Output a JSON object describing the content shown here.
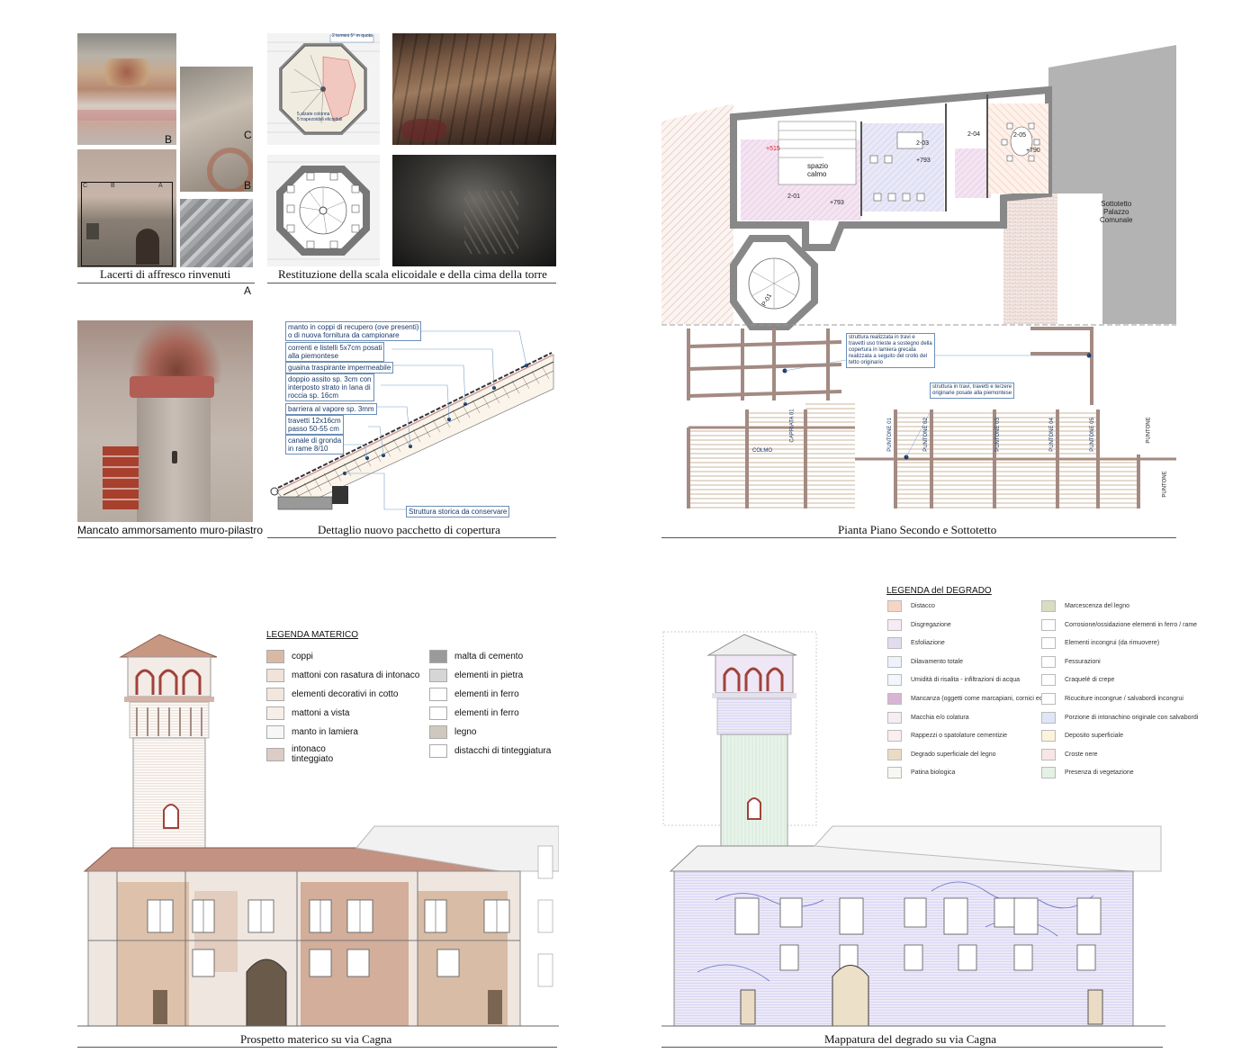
{
  "captions": {
    "fresco": "Lacerti di affresco rinvenuti",
    "stair": "Restituzione della scala elicoidale e della cima della torre",
    "wall": "Mancato ammorsamento muro-pilastro",
    "roof": "Dettaglio nuovo pacchetto di copertura",
    "plan": "Pianta Piano Secondo e Sottotetto",
    "material": "Prospetto materico su via Cagna",
    "decay": "Mappatura del degrado su via Cagna"
  },
  "fresco_tags": {
    "b1": "B",
    "c": "C",
    "b2": "B",
    "a": "A",
    "sa": "A",
    "sb": "B",
    "sc": "C"
  },
  "stair_notes": {
    "top": "2 termini 5° m quota",
    "inner": "5 alzate colonna\n5 trapezoidali elicoidali"
  },
  "roof_notes": [
    "manto in coppi di recupero (ove presenti)\no di nuova fornitura da campionare",
    "correnti e listelli 5x7cm posati\nalla piemontese",
    "guaina traspirante impermeabile",
    "doppio assito sp. 3cm con\ninterposto strato in lana di\nroccia sp. 16cm",
    "barriera al vapore sp. 3mm",
    "travetti 12x16cm\npasso 50-55 cm",
    "canale di gronda\nin rame 8/10",
    "Struttura storica da conservare"
  ],
  "plan": {
    "rooms": [
      "2-01",
      "2-03",
      "2-04",
      "2-05",
      "P-01"
    ],
    "spazio": "spazio\ncalmo",
    "levels": [
      "+515",
      "+793",
      "+793",
      "+790"
    ],
    "sottotetto": "Sottotetto\nPalazzo\nComunale",
    "note1": "struttura realizzata in travi e\ntravetti uso trieste a sostegno della\ncopertura in lamiera grecata\nrealizzata a seguito del crollo del\ntetto originario",
    "note2": "struttura in travi, travetti e terzere\noriginarie posate alla piemontese",
    "beams": [
      "COLMO",
      "CAPRIATA 01",
      "PUNTONE 01",
      "PUNTONE 02",
      "PUNTONE 03",
      "PUNTONE 04",
      "PUNTONE 05",
      "PUNTONE",
      "PUNTONE"
    ]
  },
  "legenda_materico": {
    "title": "LEGENDA MATERICO",
    "left": [
      {
        "label": "coppi",
        "color": "#d9b9a6"
      },
      {
        "label": "mattoni con rasatura di intonaco",
        "color": "#efe3da"
      },
      {
        "label": "elementi decorativi in cotto",
        "color": "#f3e6dc"
      },
      {
        "label": "mattoni a vista",
        "color": "#f6efe9"
      },
      {
        "label": "manto in lamiera",
        "color": "#f7f7f7"
      },
      {
        "label": "intonaco\ntinteggiato",
        "color": "#dccbc6"
      }
    ],
    "right": [
      {
        "label": "malta di cemento",
        "color": "#9a9a9a"
      },
      {
        "label": "elementi in pietra",
        "color": "#d6d6d6"
      },
      {
        "label": "elementi in ferro",
        "color": "#ffffff"
      },
      {
        "label": "elementi in ferro",
        "color": "#ffffff"
      },
      {
        "label": "legno",
        "color": "#cfc8bd"
      },
      {
        "label": "distacchi di tinteggiatura",
        "color": "#ffffff"
      }
    ]
  },
  "legenda_degrado": {
    "title": "LEGENDA del DEGRADO",
    "left": [
      {
        "label": "Distacco",
        "color": "#f6d5c4"
      },
      {
        "label": "Disgregazione",
        "color": "#f7eaf3"
      },
      {
        "label": "Esfoliazione",
        "color": "#e3dcef"
      },
      {
        "label": "Dilavamento totale",
        "color": "#eef2fa"
      },
      {
        "label": "Umidità di risalita - infiltrazioni di acqua",
        "color": "#f3f6fc"
      },
      {
        "label": "Mancanza (oggetti come marcapiani, cornici ecc.)",
        "color": "#d8b6d3"
      },
      {
        "label": "Macchia e/o colatura",
        "color": "#f4eef4"
      },
      {
        "label": "Rappezzi o spatolature cementizie",
        "color": "#fbeeee"
      },
      {
        "label": "Degrado superficiale del legno",
        "color": "#eadcc4"
      },
      {
        "label": "Patina biologica",
        "color": "#f7f7f3"
      }
    ],
    "right": [
      {
        "label": "Marcescenza del legno",
        "color": "#d9dcc0"
      },
      {
        "label": "Corrosione/ossidazione elementi in ferro / rame",
        "color": "#ffffff"
      },
      {
        "label": "Elementi incongrui (da rimuovere)",
        "color": "#ffffff"
      },
      {
        "label": "Fessurazioni",
        "color": "#ffffff"
      },
      {
        "label": "Craquelé di crepe",
        "color": "#ffffff"
      },
      {
        "label": "Ricuciture incongrue / salvabordi incongrui",
        "color": "#ffffff"
      },
      {
        "label": "Porzione di intonachino originale con salvabordi",
        "color": "#dfe6f6"
      },
      {
        "label": "Deposito superficiale",
        "color": "#fbf3dc"
      },
      {
        "label": "Croste nere",
        "color": "#f8e6e6"
      },
      {
        "label": "Presenza di vegetazione",
        "color": "#e4f1e4"
      }
    ]
  }
}
